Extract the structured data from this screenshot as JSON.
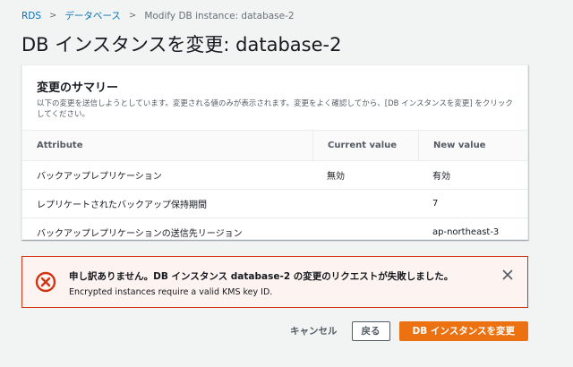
{
  "breadcrumb": {
    "items": [
      "RDS",
      "データベース"
    ],
    "current": "Modify DB instance: database-2"
  },
  "page": {
    "title": "DB インスタンスを変更: database-2"
  },
  "summary": {
    "title": "変更のサマリー",
    "description": "以下の変更を送信しようとしています。変更される値のみが表示されます。変更をよく確認してから、[DB インスタンスを変更] をクリックしてください。",
    "columns": [
      "Attribute",
      "Current value",
      "New value"
    ],
    "rows": [
      {
        "attribute": "バックアップレプリケーション",
        "current": "無効",
        "new": "有効"
      },
      {
        "attribute": "レプリケートされたバックアップ保持期間",
        "current": "",
        "new": "7"
      },
      {
        "attribute": "バックアップレプリケーションの送信先リージョン",
        "current": "",
        "new": "ap-northeast-3"
      }
    ]
  },
  "error": {
    "title": "申し訳ありません。DB インスタンス database-2 の変更のリクエストが失敗しました。",
    "detail": "Encrypted instances require a valid KMS key ID."
  },
  "actions": {
    "cancel": "キャンセル",
    "back": "戻る",
    "submit": "DB インスタンスを変更"
  },
  "colors": {
    "link": "#0073bb",
    "primary": "#ec7211",
    "error": "#d13212",
    "error_bg": "#fdf3f1",
    "background": "#f2f3f3"
  },
  "icons": {
    "breadcrumb_separator": "chevron-right-icon",
    "error": "error-circle-icon",
    "dismiss": "close-icon"
  }
}
